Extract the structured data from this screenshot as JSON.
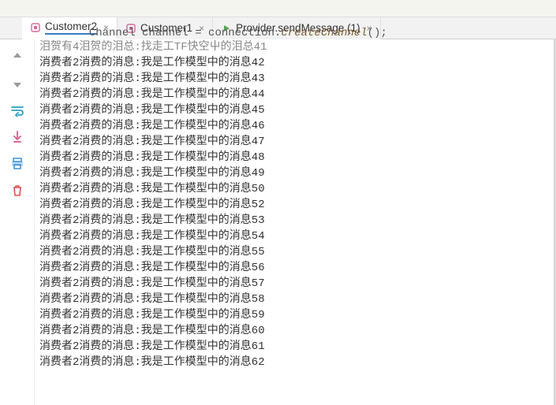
{
  "code_snippet": {
    "text_prefix": "Channel channel = connection.",
    "method": "createChannel",
    "text_suffix": "();"
  },
  "tabs": [
    {
      "label": "Customer2",
      "active": true,
      "icon": "run-pink"
    },
    {
      "label": "Customer1",
      "active": false,
      "icon": "run-pink"
    },
    {
      "label": "Provider.sendMessage (1)",
      "active": false,
      "icon": "run-green"
    }
  ],
  "gutter_icons": [
    {
      "name": "arrow-up-icon"
    },
    {
      "name": "arrow-down-icon"
    },
    {
      "name": "wrap-icon"
    },
    {
      "name": "scroll-end-icon"
    },
    {
      "name": "print-icon"
    },
    {
      "name": "trash-icon"
    }
  ],
  "colors": {
    "pink": "#d76a9a",
    "green": "#5aa35a",
    "blue": "#3c91d6",
    "red": "#d9534f",
    "cyan": "#2aa1c4"
  },
  "console": {
    "prefix": "消费者2消费的消息:我是工作模型中的消息",
    "truncated_first": "泪贺有4泪贺的泪总:找走工TF快空屮的泪总41",
    "numbers": [
      42,
      43,
      44,
      45,
      46,
      47,
      48,
      49,
      50,
      52,
      53,
      54,
      55,
      56,
      57,
      58,
      59,
      60,
      61,
      62
    ]
  }
}
